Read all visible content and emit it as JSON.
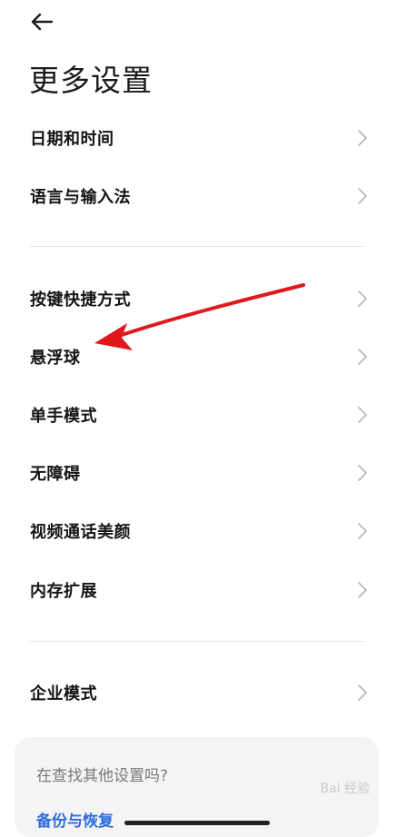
{
  "header": {
    "back_icon": "arrow-left-icon",
    "title": "更多设置"
  },
  "section1": [
    {
      "label": "日期和时间"
    },
    {
      "label": "语言与输入法"
    }
  ],
  "section2": [
    {
      "label": "按键快捷方式"
    },
    {
      "label": "悬浮球"
    },
    {
      "label": "单手模式"
    },
    {
      "label": "无障碍"
    },
    {
      "label": "视频通话美颜"
    },
    {
      "label": "内存扩展"
    }
  ],
  "section3": [
    {
      "label": "企业模式"
    }
  ],
  "search_card": {
    "prompt": "在查找其他设置吗?",
    "link": "备份与恢复"
  },
  "annotation": {
    "arrow_color": "#e0181b",
    "arrow_icon": "red-arrow-pointer"
  },
  "watermark": {
    "text": "Bai 经验"
  },
  "colors": {
    "chevron": "#b8b8b8",
    "divider": "#e6e6e6",
    "link": "#2d6de0"
  }
}
